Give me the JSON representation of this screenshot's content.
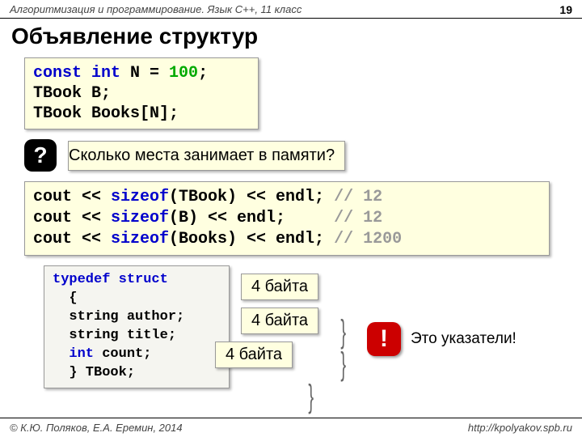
{
  "header": {
    "text": "Алгоритмизация и программирование. Язык C++, 11 класс",
    "page": "19"
  },
  "title": "Объявление структур",
  "code1": {
    "l1a": "const int",
    "l1b": " N = ",
    "l1c": "100",
    "l1d": ";",
    "l2": "TBook B;",
    "l3": "TBook Books[N];"
  },
  "question": {
    "q": "?",
    "text": "Сколько места занимает в памяти?"
  },
  "code2": {
    "l1a": "cout << ",
    "l1b": "sizeof",
    "l1c": "(TBook) << endl; ",
    "l1d": "// 12",
    "l2a": "cout << ",
    "l2b": "sizeof",
    "l2c": "(B) << endl;     ",
    "l2d": "// 12",
    "l3a": "cout << ",
    "l3b": "sizeof",
    "l3c": "(Books) << endl; ",
    "l3d": "// 1200"
  },
  "code3": {
    "l1a": "typedef",
    "l1b": " ",
    "l1c": "struct",
    "l2": "  {",
    "l3": "  string author;",
    "l4": "  string title;",
    "l5a": "  ",
    "l5b": "int",
    "l5c": " count;",
    "l6": "  } TBook;"
  },
  "bytes": {
    "b1": "4 байта",
    "b2": "4 байта",
    "b3": "4 байта"
  },
  "exclaim": {
    "mark": "!",
    "text": "Это указатели!"
  },
  "footer": {
    "left": "© К.Ю. Поляков, Е.А. Еремин, 2014",
    "right": "http://kpolyakov.spb.ru"
  }
}
